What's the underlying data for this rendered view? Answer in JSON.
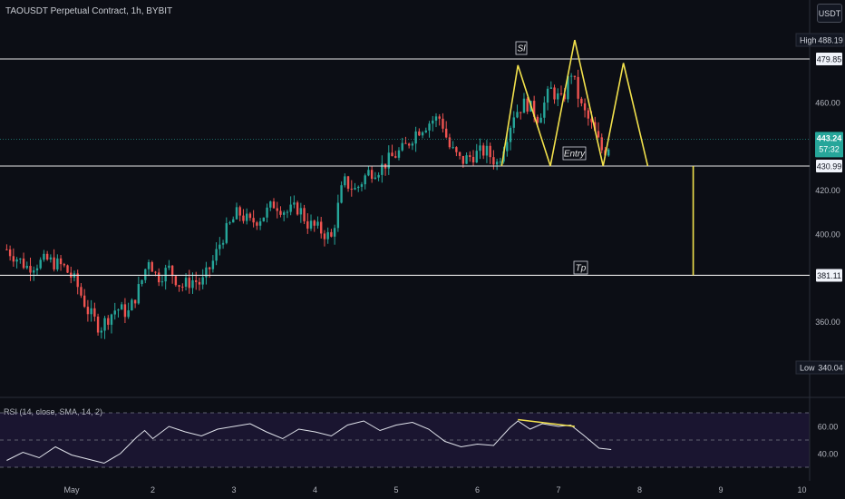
{
  "header": {
    "symbol_title": "TAOUSDT Perpetual Contract, 1h, BYBIT",
    "currency_button": "USDT"
  },
  "price_axis": {
    "high_label": "High",
    "high_value": "488.19",
    "low_label": "Low",
    "low_value": "340.04",
    "current_price": "443.24",
    "countdown": "57:32",
    "ticks": [
      "460.00",
      "420.00",
      "400.00",
      "360.00"
    ],
    "level_labels": [
      "479.85",
      "430.99",
      "381.11"
    ]
  },
  "annotations": {
    "sl": "Sl",
    "entry": "Entry",
    "tp": "Tp"
  },
  "time_axis": {
    "ticks": [
      "May",
      "2",
      "3",
      "4",
      "5",
      "6",
      "7",
      "8",
      "9",
      "10"
    ]
  },
  "rsi": {
    "title": "RSI (14, close, SMA, 14, 2)",
    "ticks": [
      "60.00",
      "40.00"
    ]
  },
  "colors": {
    "background": "#0c0e15",
    "up": "#26a69a",
    "down": "#ef5350",
    "annotation": "#f2e14c",
    "level_line": "#e6e6e6",
    "rsi_line": "#e0e3eb"
  },
  "chart_data": {
    "type": "candlestick",
    "timeframe": "1h",
    "price_range": [
      333,
      495
    ],
    "x_days_range": [
      -0.8,
      10.0
    ],
    "horizontal_levels": [
      479.85,
      430.99,
      381.11
    ],
    "current_price": 443.24,
    "session_high": 488.19,
    "session_low": 340.04,
    "price_path": [
      [
        -0.8,
        393
      ],
      [
        -0.55,
        385
      ],
      [
        -0.3,
        388
      ],
      [
        -0.1,
        385
      ],
      [
        0.05,
        378
      ],
      [
        0.2,
        365
      ],
      [
        0.35,
        357
      ],
      [
        0.45,
        362
      ],
      [
        0.55,
        366
      ],
      [
        0.7,
        364
      ],
      [
        0.85,
        377
      ],
      [
        0.95,
        389
      ],
      [
        1.05,
        380
      ],
      [
        1.2,
        384
      ],
      [
        1.35,
        376
      ],
      [
        1.5,
        379
      ],
      [
        1.6,
        377
      ],
      [
        1.75,
        388
      ],
      [
        1.85,
        398
      ],
      [
        1.95,
        404
      ],
      [
        2.05,
        410
      ],
      [
        2.2,
        405
      ],
      [
        2.35,
        408
      ],
      [
        2.5,
        414
      ],
      [
        2.65,
        410
      ],
      [
        2.8,
        412
      ],
      [
        2.9,
        405
      ],
      [
        3.05,
        402
      ],
      [
        3.2,
        398
      ],
      [
        3.35,
        424
      ],
      [
        3.5,
        420
      ],
      [
        3.65,
        428
      ],
      [
        3.8,
        430
      ],
      [
        3.95,
        435
      ],
      [
        4.1,
        439
      ],
      [
        4.25,
        447
      ],
      [
        4.45,
        452
      ],
      [
        4.55,
        453
      ],
      [
        4.65,
        440
      ],
      [
        4.8,
        433
      ],
      [
        4.95,
        436
      ],
      [
        5.1,
        438
      ],
      [
        5.25,
        432
      ],
      [
        5.45,
        455
      ],
      [
        5.6,
        460
      ],
      [
        5.75,
        453
      ],
      [
        5.9,
        466
      ],
      [
        6.05,
        460
      ],
      [
        6.15,
        475
      ],
      [
        6.28,
        458
      ],
      [
        6.4,
        450
      ],
      [
        6.55,
        437
      ],
      [
        6.65,
        442
      ]
    ],
    "pattern_lines": [
      {
        "name": "head-and-shoulders-projection",
        "points": [
          [
            5.3,
            431
          ],
          [
            5.5,
            477
          ],
          [
            5.9,
            431
          ],
          [
            6.2,
            488.5
          ],
          [
            6.55,
            431
          ],
          [
            6.8,
            478
          ],
          [
            7.1,
            430.99
          ]
        ]
      },
      {
        "name": "tp-target",
        "points": [
          [
            7.66,
            430.99
          ],
          [
            7.66,
            381.11
          ]
        ]
      }
    ],
    "rsi": {
      "range": [
        25,
        75
      ],
      "levels": [
        70,
        50,
        30
      ],
      "values": [
        [
          -0.8,
          35
        ],
        [
          -0.6,
          41
        ],
        [
          -0.4,
          37
        ],
        [
          -0.2,
          45
        ],
        [
          0.0,
          39
        ],
        [
          0.2,
          36
        ],
        [
          0.4,
          33
        ],
        [
          0.6,
          40
        ],
        [
          0.8,
          52
        ],
        [
          0.9,
          57
        ],
        [
          1.0,
          51
        ],
        [
          1.2,
          60
        ],
        [
          1.4,
          56
        ],
        [
          1.6,
          53
        ],
        [
          1.8,
          58
        ],
        [
          2.0,
          60
        ],
        [
          2.2,
          62
        ],
        [
          2.4,
          56
        ],
        [
          2.6,
          51
        ],
        [
          2.8,
          58
        ],
        [
          3.0,
          56
        ],
        [
          3.2,
          53
        ],
        [
          3.4,
          61
        ],
        [
          3.6,
          64
        ],
        [
          3.8,
          57
        ],
        [
          4.0,
          61
        ],
        [
          4.2,
          63
        ],
        [
          4.4,
          58
        ],
        [
          4.6,
          49
        ],
        [
          4.8,
          45
        ],
        [
          5.0,
          47
        ],
        [
          5.2,
          46
        ],
        [
          5.4,
          59
        ],
        [
          5.5,
          64
        ],
        [
          5.65,
          58
        ],
        [
          5.8,
          62
        ],
        [
          6.0,
          60
        ],
        [
          6.15,
          61
        ],
        [
          6.3,
          54
        ],
        [
          6.5,
          44
        ],
        [
          6.65,
          43
        ]
      ],
      "divergence_line": [
        [
          5.5,
          65
        ],
        [
          6.2,
          60
        ]
      ]
    }
  }
}
